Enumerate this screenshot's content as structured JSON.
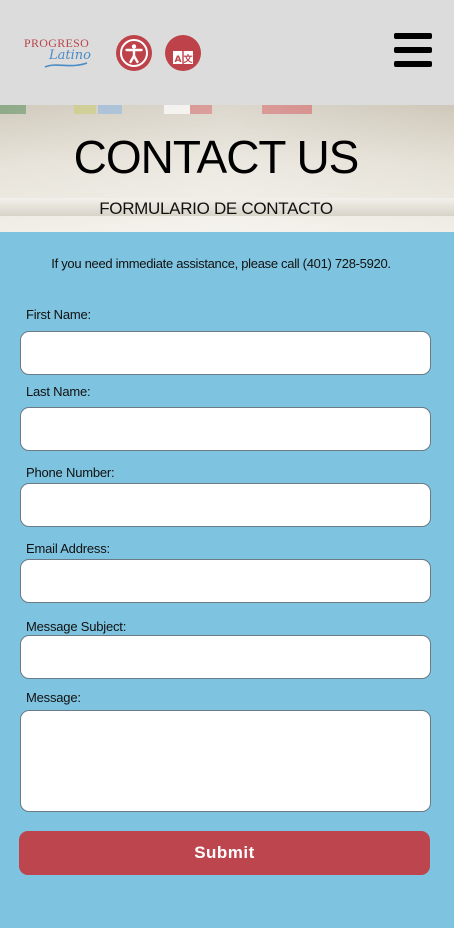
{
  "header": {
    "logo_top": "PROGRESO",
    "logo_bottom": "Latino",
    "accessibility_icon": "accessibility-icon",
    "translate_icon": "translate-icon",
    "menu_icon": "hamburger-menu-icon"
  },
  "hero": {
    "title": "CONTACT US",
    "subtitle": "FORMULARIO DE CONTACTO"
  },
  "form": {
    "notice": "If you need immediate assistance, please call (401) 728-5920.",
    "fields": [
      {
        "label": "First Name:",
        "value": ""
      },
      {
        "label": "Last Name:",
        "value": ""
      },
      {
        "label": "Phone Number:",
        "value": ""
      },
      {
        "label": "Email Address:",
        "value": ""
      },
      {
        "label": "Message Subject:",
        "value": ""
      },
      {
        "label": "Message:",
        "value": ""
      }
    ],
    "submit_label": "Submit"
  },
  "colors": {
    "header_bg": "#dcdcdc",
    "accent_red": "#bd4249",
    "form_bg": "#7ec3df",
    "logo_blue": "#4b8cc4"
  }
}
